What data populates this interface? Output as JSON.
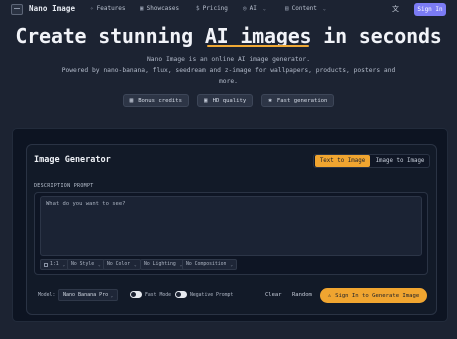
{
  "nav": {
    "brand": "Nano Image",
    "links": [
      {
        "label": "Features",
        "icon": "sparkle-icon"
      },
      {
        "label": "Showcases",
        "icon": "image-icon"
      },
      {
        "label": "Pricing",
        "icon": "dollar-icon"
      },
      {
        "label": "AI",
        "icon": "globe-icon",
        "has_dropdown": true
      },
      {
        "label": "Content",
        "icon": "document-icon",
        "has_dropdown": true
      }
    ],
    "language_icon": "translate-icon",
    "signin": "Sign In"
  },
  "hero": {
    "title_pre": "Create stunning ",
    "title_highlight": "AI images",
    "title_post": " in seconds",
    "subtitle_1": "Nano Image is an online AI image generator.",
    "subtitle_2": "Powered by nano-banana, flux, seedream and z-image for wallpapers, products, posters and",
    "subtitle_3": "more.",
    "badges": [
      {
        "label": "Bonus credits",
        "icon": "gift-icon"
      },
      {
        "label": "HD quality",
        "icon": "hd-icon"
      },
      {
        "label": "Fast generation",
        "icon": "bolt-icon"
      }
    ]
  },
  "generator": {
    "title": "Image Generator",
    "tabs": [
      "Text to Image",
      "Image to Image"
    ],
    "active_tab": 0,
    "description_label": "DESCRIPTION PROMPT",
    "prompt_value": "",
    "prompt_placeholder": "What do you want to see?",
    "options": {
      "aspect": "1:1",
      "style": "No Style",
      "color": "No Color",
      "lighting": "No Lighting",
      "composition": "No Composition"
    },
    "model_label": "Model",
    "model_value": "Nano Banana Pro",
    "fast_mode_label": "Fast Mode",
    "negative_prompt_label": "Negative Prompt",
    "clear": "Clear",
    "random": "Random",
    "generate": "Sign In to Generate Image"
  },
  "colors": {
    "accent": "#f0a530",
    "primary": "#7b7bf4",
    "background": "#1c2332",
    "panel": "#121a28"
  }
}
